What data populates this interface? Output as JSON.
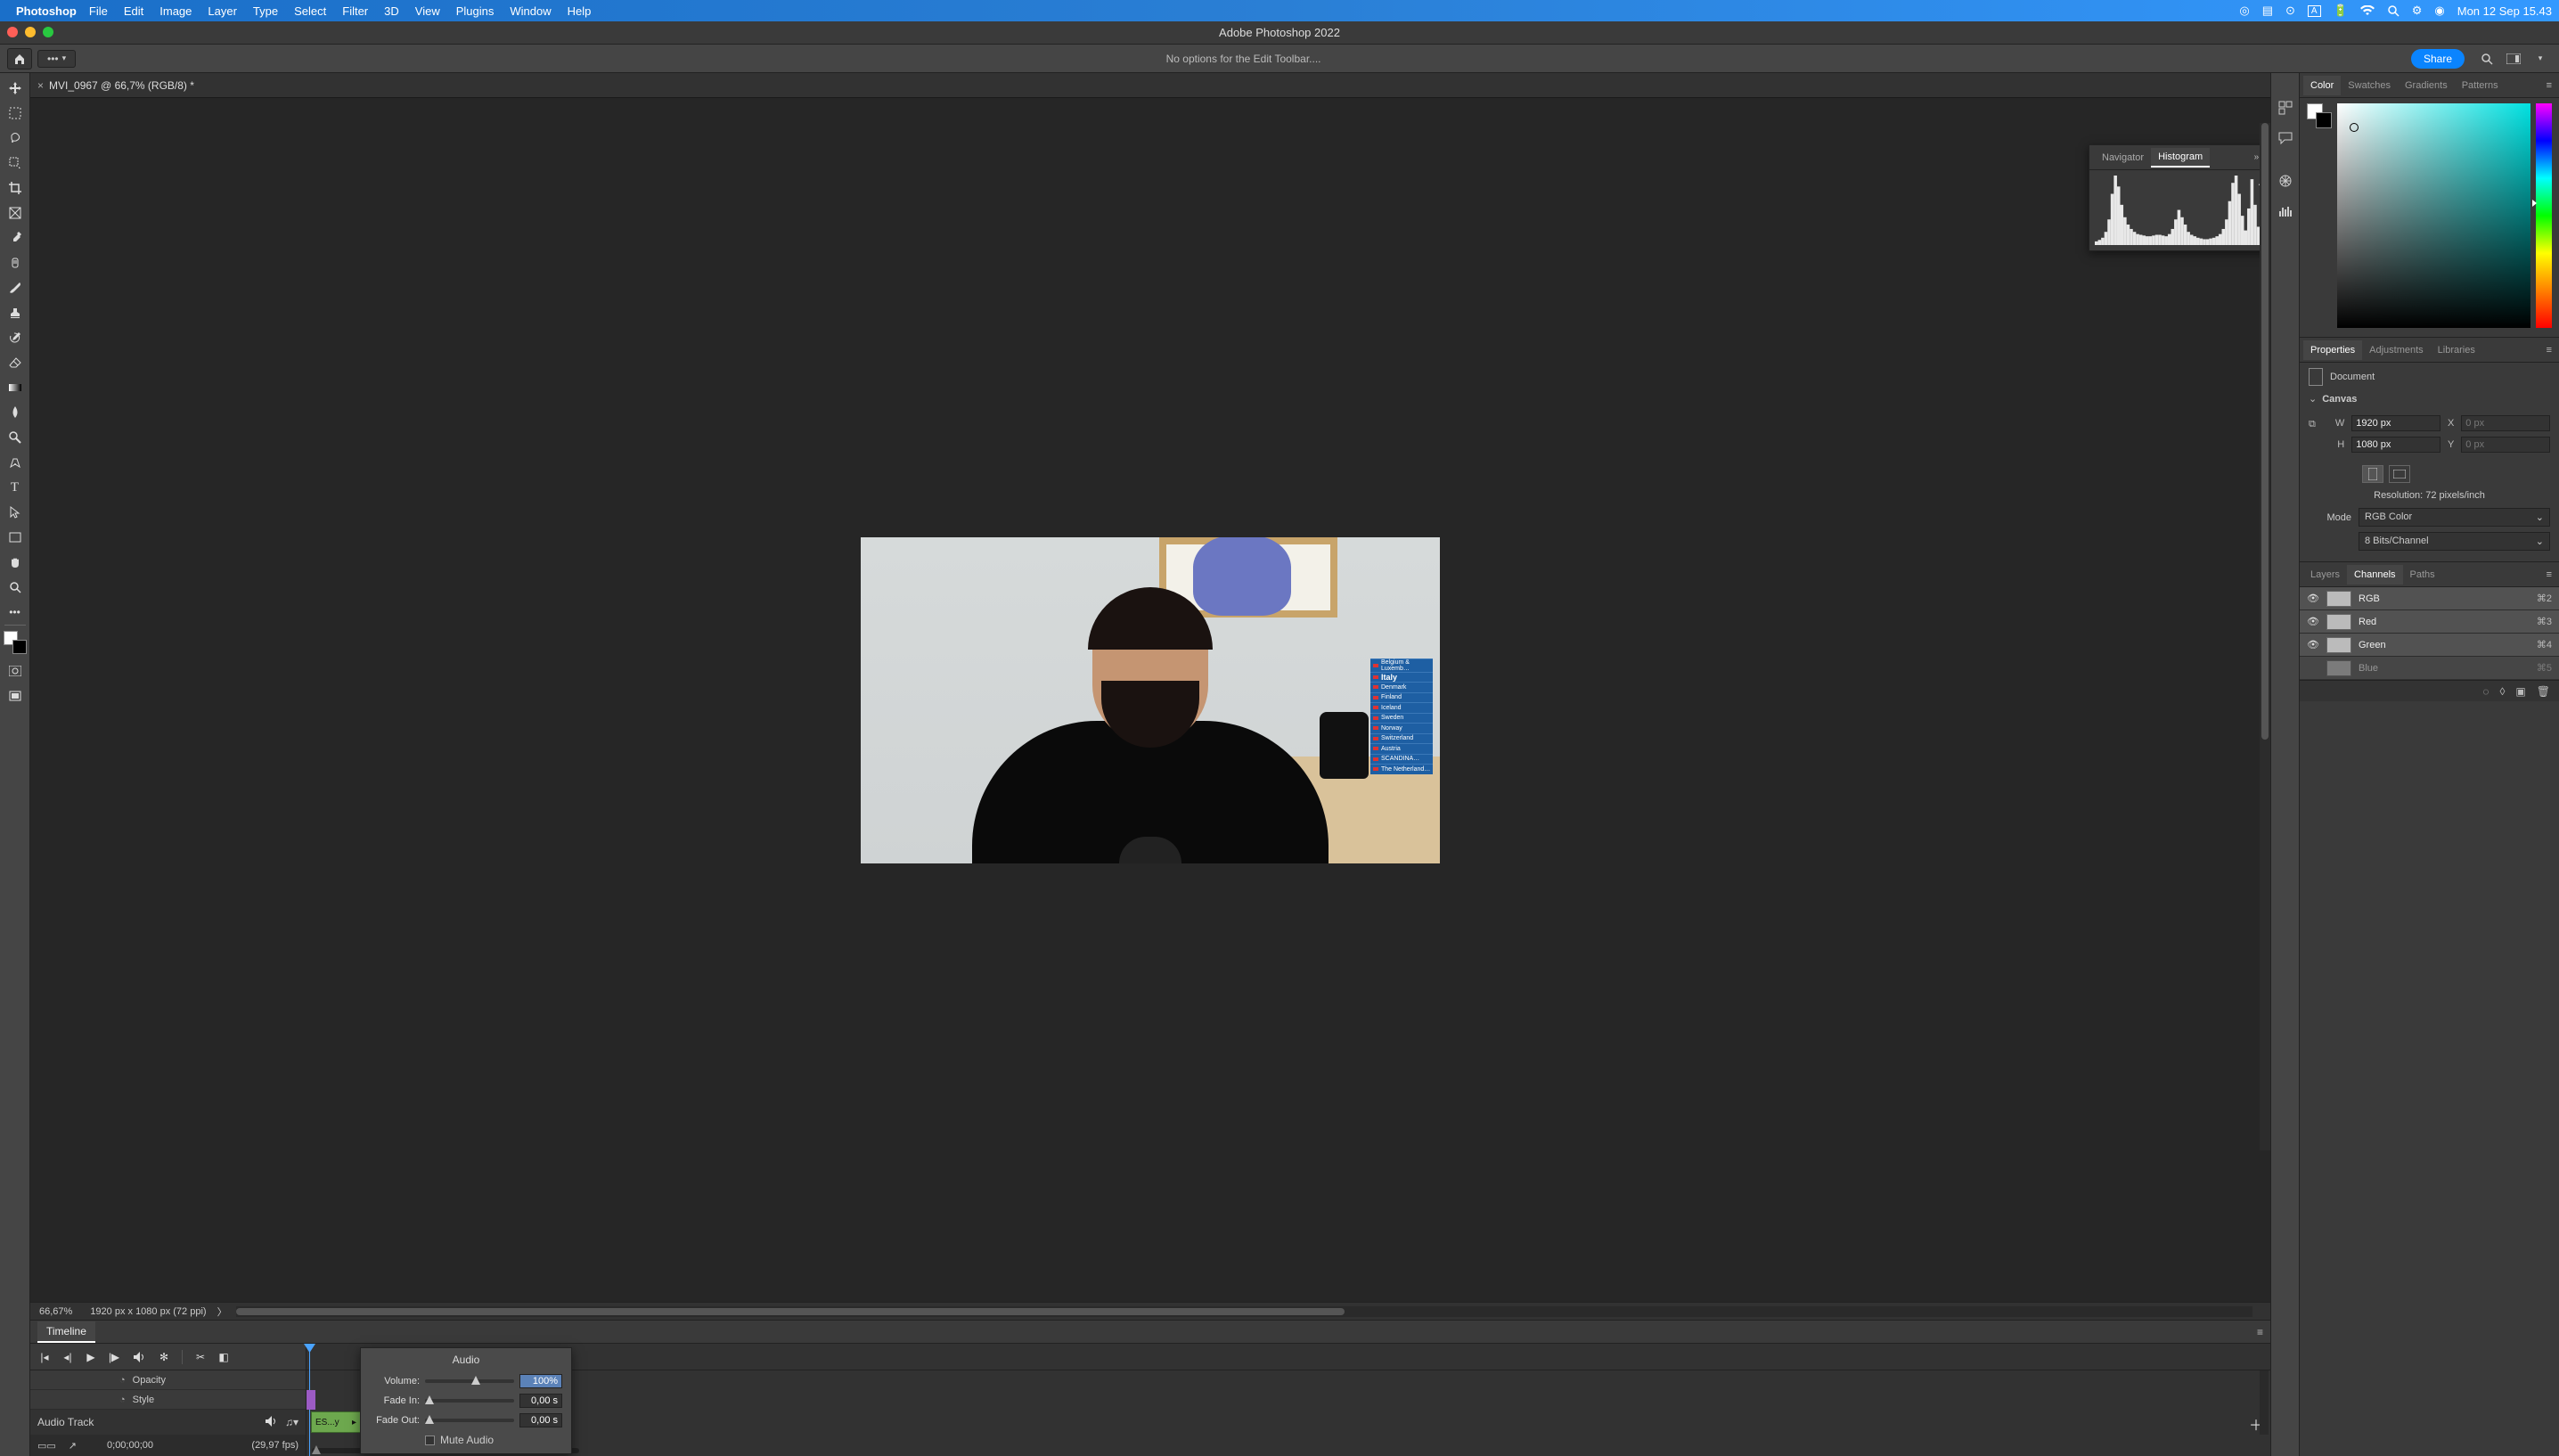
{
  "macos": {
    "app_name": "Photoshop",
    "menus": [
      "File",
      "Edit",
      "Image",
      "Layer",
      "Type",
      "Select",
      "Filter",
      "3D",
      "View",
      "Plugins",
      "Window",
      "Help"
    ],
    "clock": "Mon 12 Sep  15.43"
  },
  "window": {
    "title": "Adobe Photoshop 2022",
    "options_message": "No options for the Edit Toolbar....",
    "share": "Share"
  },
  "document": {
    "tab_close": "×",
    "tab_title": "MVI_0967 @ 66,7% (RGB/8) *",
    "books": [
      "Belgium & Luxemb…",
      "Italy",
      "Denmark",
      "Finland",
      "Iceland",
      "Sweden",
      "Norway",
      "Switzerland",
      "Austria",
      "SCANDINA…",
      "The Netherland…"
    ]
  },
  "histogram": {
    "tab_nav": "Navigator",
    "tab_hist": "Histogram",
    "bars": [
      5,
      7,
      10,
      18,
      35,
      70,
      95,
      80,
      55,
      38,
      28,
      22,
      18,
      15,
      14,
      13,
      12,
      12,
      13,
      14,
      14,
      13,
      12,
      15,
      22,
      35,
      48,
      38,
      28,
      18,
      14,
      12,
      10,
      9,
      8,
      8,
      9,
      10,
      12,
      15,
      22,
      35,
      60,
      85,
      95,
      70,
      40,
      20,
      50,
      90,
      55,
      25,
      10,
      5,
      3
    ]
  },
  "status": {
    "zoom": "66,67%",
    "dims": "1920 px x 1080 px (72 ppi)",
    "arrow": "〉"
  },
  "timeline": {
    "tab": "Timeline",
    "row_opacity": "Opacity",
    "row_style": "Style",
    "audio_track": "Audio Track",
    "clip_label": "ES...y",
    "timecode": "0;00;00;00",
    "fps": "(29,97 fps)"
  },
  "audio_popover": {
    "title": "Audio",
    "volume_label": "Volume:",
    "volume_value": "100%",
    "fade_in_label": "Fade In:",
    "fade_in_value": "0,00 s",
    "fade_out_label": "Fade Out:",
    "fade_out_value": "0,00 s",
    "mute_label": "Mute Audio"
  },
  "color_panel": {
    "tabs": [
      "Color",
      "Swatches",
      "Gradients",
      "Patterns"
    ]
  },
  "props_panel": {
    "tabs": [
      "Properties",
      "Adjustments",
      "Libraries"
    ],
    "doc_type": "Document",
    "section": "Canvas",
    "w_label": "W",
    "w_value": "1920 px",
    "h_label": "H",
    "h_value": "1080 px",
    "x_label": "X",
    "x_value": "0 px",
    "y_label": "Y",
    "y_value": "0 px",
    "resolution": "Resolution: 72 pixels/inch",
    "mode_label": "Mode",
    "mode_value": "RGB Color",
    "bits_value": "8 Bits/Channel"
  },
  "channels_panel": {
    "tabs": [
      "Layers",
      "Channels",
      "Paths"
    ],
    "rows": [
      {
        "name": "RGB",
        "shortcut": "⌘2"
      },
      {
        "name": "Red",
        "shortcut": "⌘3"
      },
      {
        "name": "Green",
        "shortcut": "⌘4"
      },
      {
        "name": "Blue",
        "shortcut": "⌘5"
      }
    ]
  }
}
